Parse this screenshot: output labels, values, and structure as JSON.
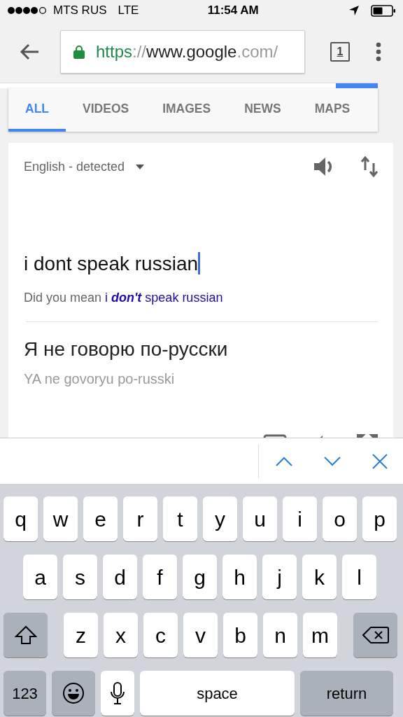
{
  "status_bar": {
    "carrier": "MTS RUS",
    "network": "LTE",
    "time": "11:54 AM"
  },
  "toolbar": {
    "url": [
      {
        "kind": "scheme",
        "text": "https"
      },
      {
        "kind": "faded",
        "text": "://"
      },
      {
        "kind": "host",
        "text": "www.google"
      },
      {
        "kind": "faded",
        "text": ".com/"
      }
    ],
    "tab_count": "1"
  },
  "tabs": [
    {
      "label": "ALL",
      "selected": true
    },
    {
      "label": "VIDEOS",
      "selected": false
    },
    {
      "label": "IMAGES",
      "selected": false
    },
    {
      "label": "NEWS",
      "selected": false
    },
    {
      "label": "MAPS",
      "selected": false
    }
  ],
  "translate": {
    "source_language": "English - detected",
    "input": "i dont speak russian",
    "suggestion_prefix": "Did you mean",
    "suggestion": "i **don't** speak russian",
    "translation": "Я не говорю по-русски",
    "transliteration": "YA ne govoryu po-russki"
  },
  "keyboard": {
    "rows": [
      {
        "keys": [
          {
            "kind": "letter",
            "label": "q"
          },
          {
            "kind": "letter",
            "label": "w"
          },
          {
            "kind": "letter",
            "label": "e"
          },
          {
            "kind": "letter",
            "label": "r"
          },
          {
            "kind": "letter",
            "label": "t"
          },
          {
            "kind": "letter",
            "label": "y"
          },
          {
            "kind": "letter",
            "label": "u"
          },
          {
            "kind": "letter",
            "label": "i"
          },
          {
            "kind": "letter",
            "label": "o"
          },
          {
            "kind": "letter",
            "label": "p"
          }
        ]
      },
      {
        "keys": [
          {
            "kind": "letter",
            "label": "a"
          },
          {
            "kind": "letter",
            "label": "s"
          },
          {
            "kind": "letter",
            "label": "d"
          },
          {
            "kind": "letter",
            "label": "f"
          },
          {
            "kind": "letter",
            "label": "g"
          },
          {
            "kind": "letter",
            "label": "h"
          },
          {
            "kind": "letter",
            "label": "j"
          },
          {
            "kind": "letter",
            "label": "k"
          },
          {
            "kind": "letter",
            "label": "l"
          }
        ]
      },
      {
        "keys": [
          {
            "kind": "shift"
          },
          {
            "kind": "letter",
            "label": "z"
          },
          {
            "kind": "letter",
            "label": "x"
          },
          {
            "kind": "letter",
            "label": "c"
          },
          {
            "kind": "letter",
            "label": "v"
          },
          {
            "kind": "letter",
            "label": "b"
          },
          {
            "kind": "letter",
            "label": "n"
          },
          {
            "kind": "letter",
            "label": "m"
          },
          {
            "kind": "backspace"
          }
        ]
      },
      {
        "keys": [
          {
            "kind": "numbers",
            "label": "123"
          },
          {
            "kind": "emoji"
          },
          {
            "kind": "mic"
          },
          {
            "kind": "space",
            "label": "space"
          },
          {
            "kind": "return",
            "label": "return"
          }
        ]
      }
    ]
  }
}
